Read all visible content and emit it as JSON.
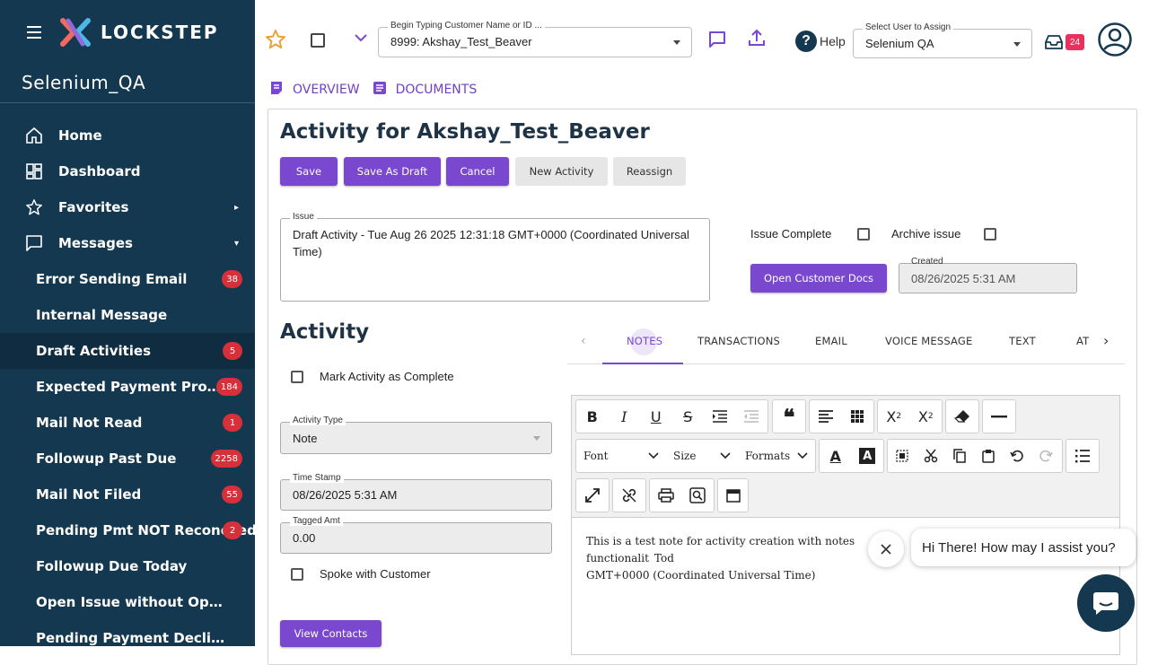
{
  "app": {
    "logo_text": "LOCKSTEP",
    "org_name": "Selenium_QA"
  },
  "colors": {
    "sidebar": "#14384f",
    "accent": "#7a47cf",
    "badge": "#d6303a",
    "inbox_badge": "#e8315c"
  },
  "sidebar": {
    "items": [
      {
        "label": "Home",
        "icon": "home-icon"
      },
      {
        "label": "Dashboard",
        "icon": "dashboard-icon"
      },
      {
        "label": "Favorites",
        "icon": "star-icon",
        "arrow": "▸"
      },
      {
        "label": "Messages",
        "icon": "message-icon",
        "arrow": "▾"
      }
    ],
    "messages": [
      {
        "label": "Error Sending Email",
        "badge": "38"
      },
      {
        "label": "Internal Message",
        "badge": ""
      },
      {
        "label": "Draft Activities",
        "badge": "5"
      },
      {
        "label": "Expected Payment Promise...",
        "badge": "184"
      },
      {
        "label": "Mail Not Read",
        "badge": "1"
      },
      {
        "label": "Followup Past Due",
        "badge": "2258"
      },
      {
        "label": "Mail Not Filed",
        "badge": "55"
      },
      {
        "label": "Pending Pmt NOT Reconciled",
        "badge": "2"
      },
      {
        "label": "Followup Due Today",
        "badge": ""
      },
      {
        "label": "Open Issue without Open A...",
        "badge": ""
      },
      {
        "label": "Pending Payment Declined ...",
        "badge": ""
      }
    ]
  },
  "topbar": {
    "customer_label": "Begin Typing Customer Name or ID ...",
    "customer_value": "8999: Akshay_Test_Beaver",
    "help_label": "Help",
    "assign_label": "Select User to Assign",
    "assign_value": "Selenium QA",
    "inbox_count": "24"
  },
  "page_tabs": {
    "overview": "OVERVIEW",
    "documents": "DOCUMENTS"
  },
  "activity": {
    "title": "Activity for Akshay_Test_Beaver",
    "buttons": {
      "save": "Save",
      "save_draft": "Save As Draft",
      "cancel": "Cancel",
      "new_activity": "New Activity",
      "reassign": "Reassign"
    },
    "issue_label": "Issue",
    "issue_text": "Draft Activity - Tue Aug 26 2025 12:31:18 GMT+0000 (Coordinated Universal Time)",
    "issue_complete": "Issue Complete",
    "archive_issue": "Archive issue",
    "open_docs": "Open Customer Docs",
    "created_label": "Created",
    "created_value": "08/26/2025 5:31 AM",
    "section_title": "Activity",
    "mark_complete": "Mark Activity as Complete",
    "type_label": "Activity Type",
    "type_value": "Note",
    "timestamp_label": "Time Stamp",
    "timestamp_value": "08/26/2025 5:31 AM",
    "tagged_label": "Tagged Amt",
    "tagged_value": "0.00",
    "spoke": "Spoke with Customer",
    "view_contacts": "View Contacts"
  },
  "activity_tabs": [
    "NOTES",
    "TRANSACTIONS",
    "EMAIL",
    "VOICE MESSAGE",
    "TEXT",
    "AT"
  ],
  "editor": {
    "font": "Font",
    "size": "Size",
    "formats": "Formats",
    "body_line1": "This is a test note for activity creation with notes functionalit",
    "body_line1_end": "Tod",
    "body_line2": "GMT+0000 (Coordinated Universal Time)"
  },
  "chat": {
    "greeting": "Hi There! How may I assist you?"
  }
}
